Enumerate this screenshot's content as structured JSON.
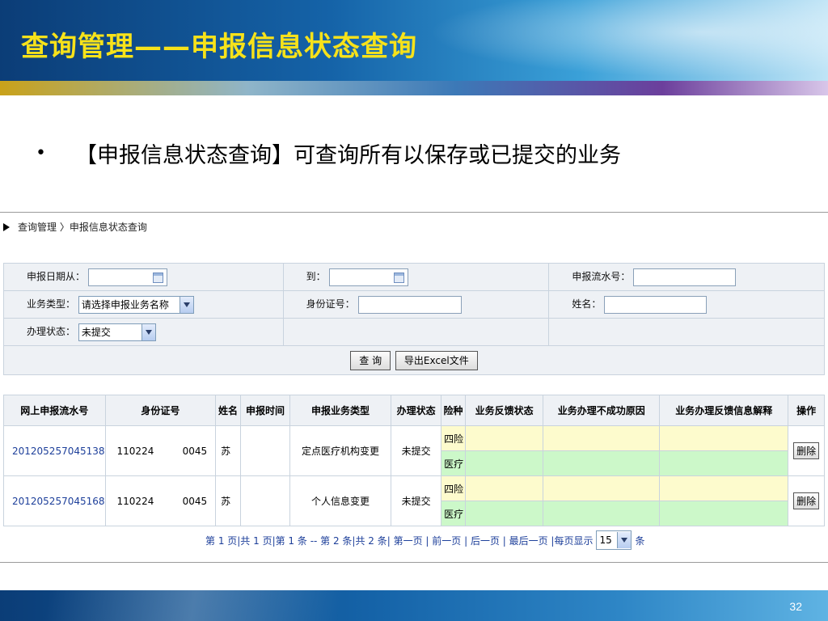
{
  "slide": {
    "title": "查询管理——申报信息状态查询",
    "bullet": "【申报信息状态查询】可查询所有以保存或已提交的业务",
    "page_number": "32"
  },
  "app": {
    "breadcrumb": "查询管理 〉申报信息状态查询",
    "form": {
      "date_from_label": "申报日期从：",
      "date_from_value": "",
      "date_to_label": "到：",
      "date_to_value": "",
      "flow_no_label": "申报流水号：",
      "flow_no_value": "",
      "biz_type_label": "业务类型：",
      "biz_type_value": "请选择申报业务名称",
      "id_label": "身份证号：",
      "id_value": "",
      "name_label": "姓名：",
      "name_value": "",
      "status_label": "办理状态：",
      "status_value": "未提交",
      "query_button": "查 询",
      "export_button": "导出Excel文件"
    },
    "table": {
      "headers": [
        "网上申报流水号",
        "身份证号",
        "姓名",
        "申报时间",
        "申报业务类型",
        "办理状态",
        "险种",
        "业务反馈状态",
        "业务办理不成功原因",
        "业务办理反馈信息解释",
        "操作"
      ],
      "rows": [
        {
          "flow_no": "201205257045138",
          "id_a": "110224",
          "id_b": "0045",
          "name": "苏",
          "time": "",
          "biz_type": "定点医疗机构变更",
          "status": "未提交",
          "insurance": [
            "四险",
            "医疗"
          ],
          "action": "删除"
        },
        {
          "flow_no": "201205257045168",
          "id_a": "110224",
          "id_b": "0045",
          "name": "苏",
          "time": "",
          "biz_type": "个人信息变更",
          "status": "未提交",
          "insurance": [
            "四险",
            "医疗"
          ],
          "action": "删除"
        }
      ]
    },
    "pager": {
      "text": "第 1 页|共 1 页|第 1 条 -- 第 2 条|共 2 条| 第一页 | 前一页 | 后一页 | 最后一页 |每页显示",
      "page_size": "15",
      "unit": "条"
    }
  },
  "colors": {
    "title_yellow": "#f7e21a",
    "link_blue": "#1d3f9a",
    "feedback_yellow": "#fdfbcd",
    "feedback_green": "#ccf8c9"
  }
}
